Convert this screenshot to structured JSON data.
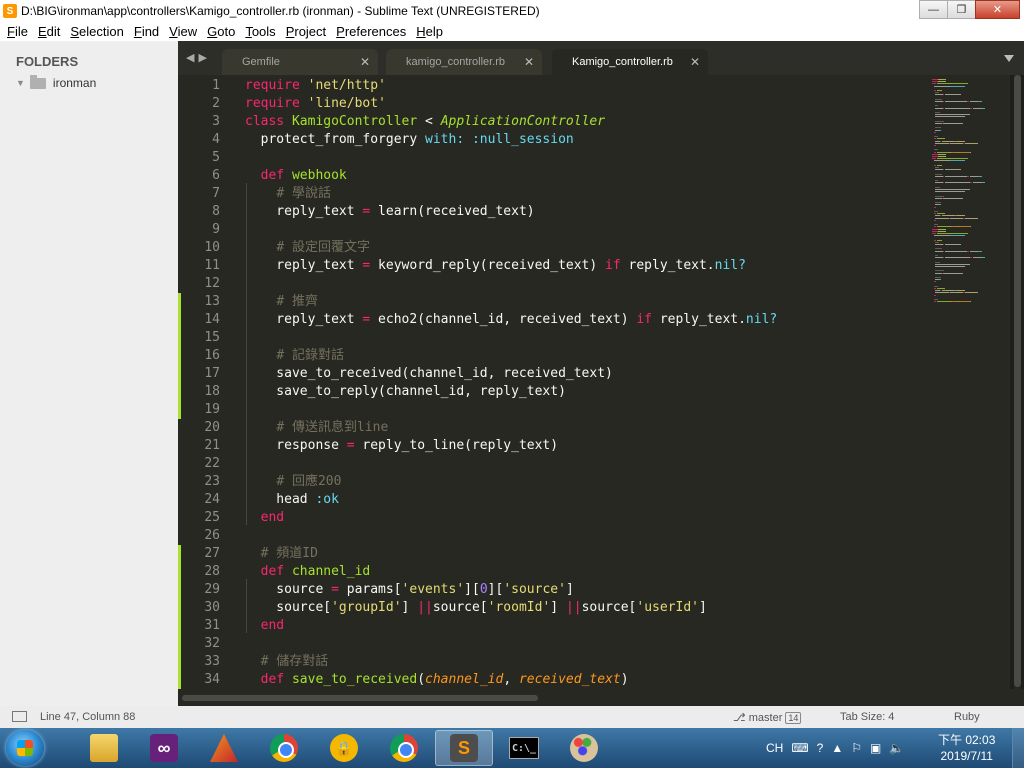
{
  "window": {
    "title": "D:\\BIG\\ironman\\app\\controllers\\Kamigo_controller.rb (ironman) - Sublime Text (UNREGISTERED)",
    "app_icon_letter": "S",
    "minimize_glyph": "—",
    "maximize_glyph": "❐",
    "close_glyph": "✕"
  },
  "menu": [
    "File",
    "Edit",
    "Selection",
    "Find",
    "View",
    "Goto",
    "Tools",
    "Project",
    "Preferences",
    "Help"
  ],
  "sidebar": {
    "header": "FOLDERS",
    "root_folder": "ironman"
  },
  "tabs": [
    {
      "label": "Gemfile",
      "active": false
    },
    {
      "label": "kamigo_controller.rb",
      "active": false
    },
    {
      "label": "Kamigo_controller.rb",
      "active": true
    }
  ],
  "editor": {
    "syntax_colors": {
      "background": "#272822",
      "keyword": "#f92672",
      "string": "#e6db74",
      "comment": "#75715e",
      "function": "#a6e22e",
      "constant": "#66d9ef",
      "parameter": "#fd971f",
      "number": "#ae81ff"
    },
    "lines": [
      {
        "n": 1,
        "mod": false,
        "tokens": [
          [
            "kw",
            "require"
          ],
          [
            "t",
            " "
          ],
          [
            "st",
            "'net/http'"
          ]
        ]
      },
      {
        "n": 2,
        "mod": false,
        "tokens": [
          [
            "kw",
            "require"
          ],
          [
            "t",
            " "
          ],
          [
            "st",
            "'line/bot'"
          ]
        ]
      },
      {
        "n": 3,
        "mod": false,
        "tokens": [
          [
            "kw",
            "class"
          ],
          [
            "t",
            " "
          ],
          [
            "fn",
            "KamigoController"
          ],
          [
            "t",
            " < "
          ],
          [
            "ic",
            "ApplicationController"
          ]
        ]
      },
      {
        "n": 4,
        "mod": false,
        "tokens": [
          [
            "t",
            "  protect_from_forgery "
          ],
          [
            "cs",
            "with:"
          ],
          [
            "t",
            " "
          ],
          [
            "cs",
            ":null_session"
          ]
        ]
      },
      {
        "n": 5,
        "mod": false,
        "tokens": []
      },
      {
        "n": 6,
        "mod": false,
        "tokens": [
          [
            "t",
            "  "
          ],
          [
            "kw",
            "def"
          ],
          [
            "t",
            " "
          ],
          [
            "fn",
            "webhook"
          ]
        ]
      },
      {
        "n": 7,
        "mod": false,
        "tokens": [
          [
            "t",
            "    "
          ],
          [
            "cm",
            "# 學說話"
          ]
        ]
      },
      {
        "n": 8,
        "mod": false,
        "tokens": [
          [
            "t",
            "    reply_text "
          ],
          [
            "kw",
            "="
          ],
          [
            "t",
            " learn(received_text)"
          ]
        ]
      },
      {
        "n": 9,
        "mod": false,
        "tokens": []
      },
      {
        "n": 10,
        "mod": false,
        "tokens": [
          [
            "t",
            "    "
          ],
          [
            "cm",
            "# 設定回覆文字"
          ]
        ]
      },
      {
        "n": 11,
        "mod": false,
        "tokens": [
          [
            "t",
            "    reply_text "
          ],
          [
            "kw",
            "="
          ],
          [
            "t",
            " keyword_reply(received_text) "
          ],
          [
            "kw",
            "if"
          ],
          [
            "t",
            " reply_text."
          ],
          [
            "cs",
            "nil?"
          ]
        ]
      },
      {
        "n": 12,
        "mod": false,
        "tokens": []
      },
      {
        "n": 13,
        "mod": true,
        "tokens": [
          [
            "t",
            "    "
          ],
          [
            "cm",
            "# 推齊"
          ]
        ]
      },
      {
        "n": 14,
        "mod": true,
        "tokens": [
          [
            "t",
            "    reply_text "
          ],
          [
            "kw",
            "="
          ],
          [
            "t",
            " echo2(channel_id, received_text) "
          ],
          [
            "kw",
            "if"
          ],
          [
            "t",
            " reply_text."
          ],
          [
            "cs",
            "nil?"
          ]
        ]
      },
      {
        "n": 15,
        "mod": true,
        "tokens": []
      },
      {
        "n": 16,
        "mod": true,
        "tokens": [
          [
            "t",
            "    "
          ],
          [
            "cm",
            "# 記錄對話"
          ]
        ]
      },
      {
        "n": 17,
        "mod": true,
        "tokens": [
          [
            "t",
            "    save_to_received(channel_id, received_text)"
          ]
        ]
      },
      {
        "n": 18,
        "mod": true,
        "tokens": [
          [
            "t",
            "    save_to_reply(channel_id, reply_text)"
          ]
        ]
      },
      {
        "n": 19,
        "mod": true,
        "tokens": []
      },
      {
        "n": 20,
        "mod": false,
        "tokens": [
          [
            "t",
            "    "
          ],
          [
            "cm",
            "# 傳送訊息到line"
          ]
        ]
      },
      {
        "n": 21,
        "mod": false,
        "tokens": [
          [
            "t",
            "    response "
          ],
          [
            "kw",
            "="
          ],
          [
            "t",
            " reply_to_line(reply_text)"
          ]
        ]
      },
      {
        "n": 22,
        "mod": false,
        "tokens": []
      },
      {
        "n": 23,
        "mod": false,
        "tokens": [
          [
            "t",
            "    "
          ],
          [
            "cm",
            "# 回應200"
          ]
        ]
      },
      {
        "n": 24,
        "mod": false,
        "tokens": [
          [
            "t",
            "    head "
          ],
          [
            "cs",
            ":ok"
          ]
        ]
      },
      {
        "n": 25,
        "mod": false,
        "tokens": [
          [
            "t",
            "  "
          ],
          [
            "kw",
            "end"
          ]
        ]
      },
      {
        "n": 26,
        "mod": false,
        "tokens": []
      },
      {
        "n": 27,
        "mod": true,
        "tokens": [
          [
            "t",
            "  "
          ],
          [
            "cm",
            "# 頻道ID"
          ]
        ]
      },
      {
        "n": 28,
        "mod": true,
        "tokens": [
          [
            "t",
            "  "
          ],
          [
            "kw",
            "def"
          ],
          [
            "t",
            " "
          ],
          [
            "fn",
            "channel_id"
          ]
        ]
      },
      {
        "n": 29,
        "mod": true,
        "tokens": [
          [
            "t",
            "    source "
          ],
          [
            "kw",
            "="
          ],
          [
            "t",
            " params["
          ],
          [
            "st",
            "'events'"
          ],
          [
            "t",
            "]["
          ],
          [
            "nu",
            "0"
          ],
          [
            "t",
            "]["
          ],
          [
            "st",
            "'source'"
          ],
          [
            "t",
            "]"
          ]
        ]
      },
      {
        "n": 30,
        "mod": true,
        "tokens": [
          [
            "t",
            "    source["
          ],
          [
            "st",
            "'groupId'"
          ],
          [
            "t",
            "] "
          ],
          [
            "kw",
            "||"
          ],
          [
            "t",
            "source["
          ],
          [
            "st",
            "'roomId'"
          ],
          [
            "t",
            "] "
          ],
          [
            "kw",
            "||"
          ],
          [
            "t",
            "source["
          ],
          [
            "st",
            "'userId'"
          ],
          [
            "t",
            "]"
          ]
        ]
      },
      {
        "n": 31,
        "mod": true,
        "tokens": [
          [
            "t",
            "  "
          ],
          [
            "kw",
            "end"
          ]
        ]
      },
      {
        "n": 32,
        "mod": true,
        "tokens": []
      },
      {
        "n": 33,
        "mod": true,
        "tokens": [
          [
            "t",
            "  "
          ],
          [
            "cm",
            "# 儲存對話"
          ]
        ]
      },
      {
        "n": 34,
        "mod": true,
        "tokens": [
          [
            "t",
            "  "
          ],
          [
            "kw",
            "def"
          ],
          [
            "t",
            " "
          ],
          [
            "fn",
            "save_to_received"
          ],
          [
            "t",
            "("
          ],
          [
            "pa",
            "channel_id"
          ],
          [
            "t",
            ", "
          ],
          [
            "pa",
            "received_text"
          ],
          [
            "t",
            ")"
          ]
        ]
      }
    ]
  },
  "statusbar": {
    "position": "Line 47, Column 88",
    "branch": "master",
    "branch_count": "14",
    "tab_size": "Tab Size: 4",
    "syntax": "Ruby"
  },
  "taskbar": {
    "apps": [
      {
        "name": "windows-explorer",
        "icon": "folder-icon",
        "glyph": ""
      },
      {
        "name": "visual-studio",
        "icon": "visual-studio-icon",
        "glyph": "∞"
      },
      {
        "name": "matlab",
        "icon": "matlab-icon",
        "glyph": ""
      },
      {
        "name": "chrome",
        "icon": "chrome-icon",
        "glyph": ""
      },
      {
        "name": "security",
        "icon": "lock-icon",
        "glyph": "🔒"
      },
      {
        "name": "chrome-2",
        "icon": "chrome-icon",
        "glyph": ""
      },
      {
        "name": "sublime-text",
        "icon": "sublime-icon",
        "glyph": "S"
      },
      {
        "name": "command-prompt",
        "icon": "cmd-icon",
        "glyph": "C:\\_"
      },
      {
        "name": "paint",
        "icon": "paint-icon",
        "glyph": ""
      }
    ],
    "active_app": "sublime-text",
    "tray": {
      "ime": "CH",
      "keyboard_glyph": "⌨",
      "help_glyph": "?",
      "arrow_glyph": "▲",
      "flag_glyph": "⚐",
      "network_glyph": "▣",
      "volume_glyph": "🔈"
    },
    "clock_time": "下午 02:03",
    "clock_date": "2019/7/11"
  }
}
